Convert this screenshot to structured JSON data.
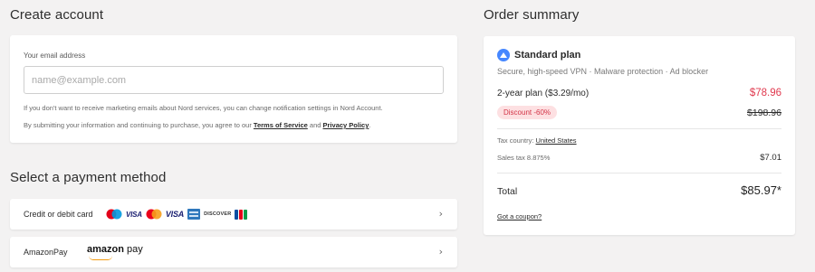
{
  "account": {
    "heading": "Create account",
    "email_label": "Your email address",
    "email_placeholder": "name@example.com",
    "marketing_note": "If you don't want to receive marketing emails about Nord services, you can change notification settings in Nord Account.",
    "terms_prefix": "By submitting your information and continuing to purchase, you agree to our",
    "terms_link": "Terms of Service",
    "terms_and": "and",
    "privacy_link": "Privacy Policy",
    "terms_suffix": "."
  },
  "payment": {
    "heading": "Select a payment method",
    "methods": [
      {
        "label": "Credit or debit card",
        "logos": [
          "maestro-icon",
          "visa-icon",
          "mastercard-icon",
          "visa-icon",
          "amex-icon",
          "discover-icon",
          "jcb-icon"
        ],
        "visa_text": "VISA",
        "discover_text": "DISCOVER"
      },
      {
        "label": "AmazonPay",
        "logo_bold": "amazon",
        "logo_rest": " pay"
      }
    ],
    "chevron": "›"
  },
  "summary": {
    "heading": "Order summary",
    "plan_name": "Standard plan",
    "plan_icon": "nordvpn-icon",
    "plan_desc": "Secure, high-speed VPN · Malware protection · Ad blocker",
    "term": "2-year plan ($3.29/mo)",
    "price": "$78.96",
    "discount": "Discount -60%",
    "old_price": "$198.96",
    "tax_country_label": "Tax country:",
    "tax_country": "United States",
    "sales_tax_label": "Sales tax 8.875%",
    "sales_tax": "$7.01",
    "total_label": "Total",
    "total": "$85.97*",
    "coupon": "Got a coupon?"
  },
  "colors": {
    "background": "#f3f2f2",
    "accent_red": "#e0394e",
    "discount_bg": "#fde0e2",
    "plan_blue": "#4687ff"
  }
}
